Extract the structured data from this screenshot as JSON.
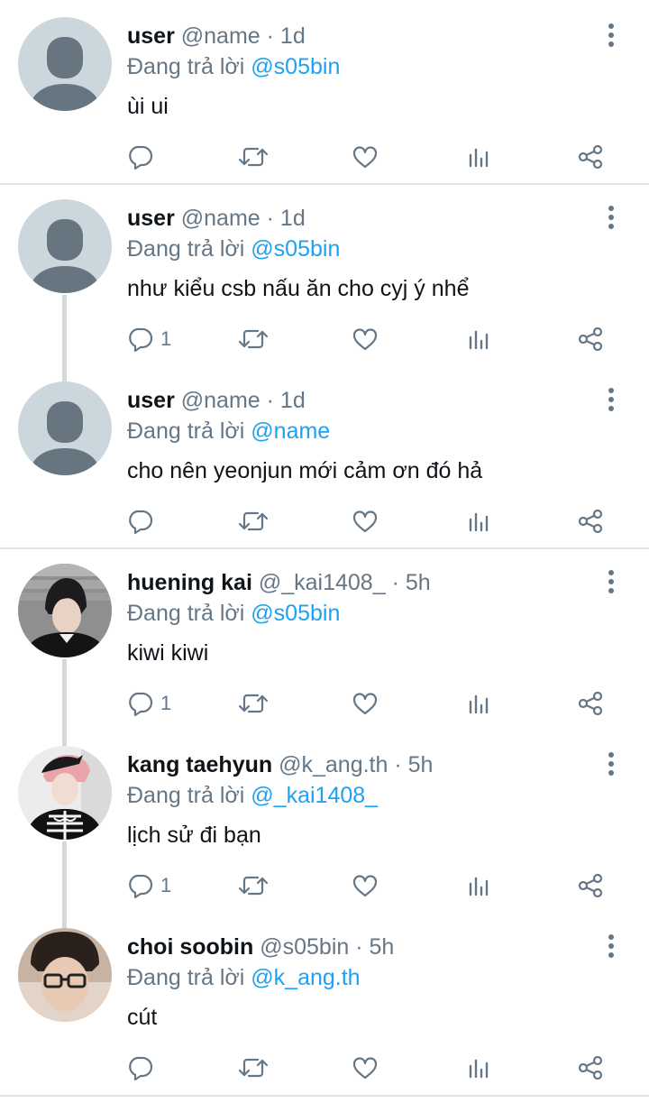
{
  "reply_prefix": "Đang trả lời",
  "colors": {
    "mention": "#1da1f2",
    "meta": "#657786",
    "text": "#0f1419",
    "divider": "#e1e4e8"
  },
  "icons": {
    "more": "more-vertical-icon",
    "reply": "reply-bubble-icon",
    "retweet": "retweet-icon",
    "like": "heart-icon",
    "stats": "analytics-icon",
    "share": "share-icon"
  },
  "tweets": [
    {
      "name": "user",
      "handle": "@name",
      "sep": "·",
      "time": "1d",
      "reply_to": "@s05bin",
      "text": "ùi ui",
      "reply_count": ""
    },
    {
      "name": "user",
      "handle": "@name",
      "sep": "·",
      "time": "1d",
      "reply_to": "@s05bin",
      "text": "như kiểu csb nấu ăn cho cyj ý nhể",
      "reply_count": "1"
    },
    {
      "name": "user",
      "handle": "@name",
      "sep": "·",
      "time": "1d",
      "reply_to": "@name",
      "text": "cho nên yeonjun mới cảm ơn đó hả",
      "reply_count": ""
    },
    {
      "name": "huening kai",
      "handle": "@_kai1408_",
      "sep": "·",
      "time": "5h",
      "reply_to": "@s05bin",
      "text": "kiwi kiwi",
      "reply_count": "1"
    },
    {
      "name": "kang taehyun",
      "handle": "@k_ang.th",
      "sep": "·",
      "time": "5h",
      "reply_to": "@_kai1408_",
      "text": "lịch sử đi bạn",
      "reply_count": "1"
    },
    {
      "name": "choi soobin",
      "handle": "@s05bin",
      "sep": "·",
      "time": "5h",
      "reply_to": "@k_ang.th",
      "text": "cút",
      "reply_count": ""
    }
  ]
}
